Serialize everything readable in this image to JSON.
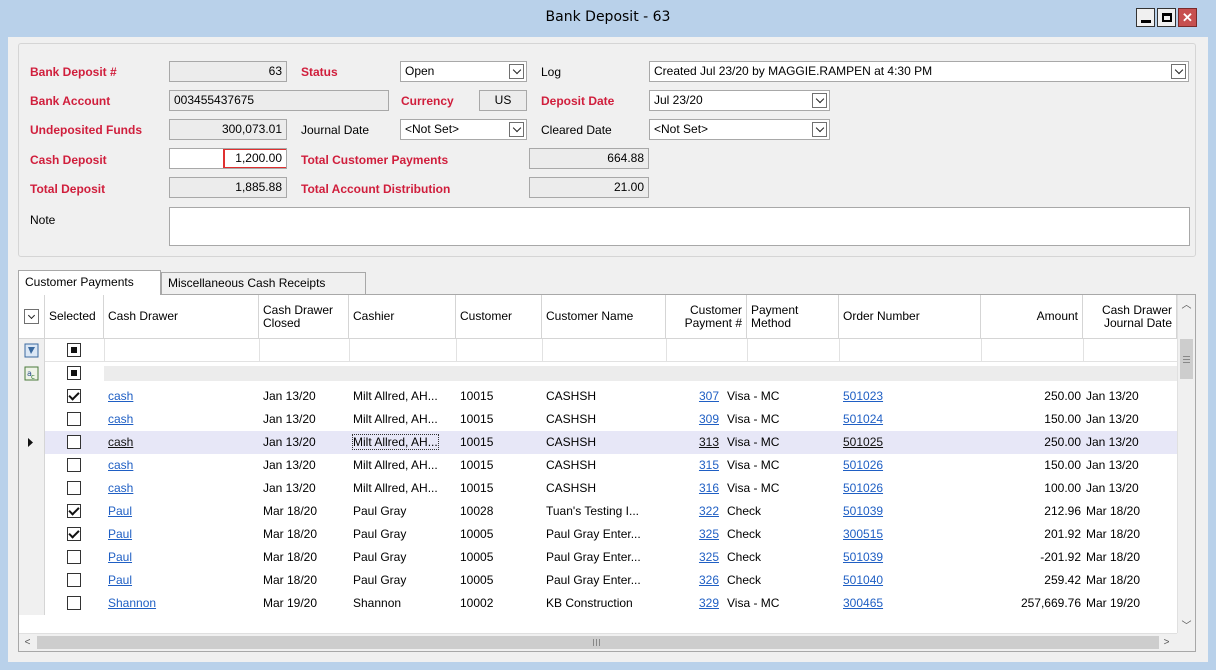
{
  "window": {
    "title": "Bank Deposit - 63"
  },
  "header": {
    "bank_deposit_label": "Bank Deposit #",
    "bank_deposit_value": "63",
    "status_label": "Status",
    "status_value": "Open",
    "log_label": "Log",
    "log_value": "Created Jul 23/20 by MAGGIE.RAMPEN at 4:30 PM",
    "bank_account_label": "Bank Account",
    "bank_account_value": "003455437675",
    "currency_label": "Currency",
    "currency_value": "US",
    "deposit_date_label": "Deposit Date",
    "deposit_date_value": "Jul 23/20",
    "undeposited_label": "Undeposited Funds",
    "undeposited_value": "300,073.01",
    "journal_date_label": "Journal Date",
    "journal_date_value": "<Not Set>",
    "cleared_date_label": "Cleared Date",
    "cleared_date_value": "<Not Set>",
    "cash_deposit_label": "Cash Deposit",
    "cash_deposit_value": "1,200.00",
    "total_customer_payments_label": "Total Customer Payments",
    "total_customer_payments_value": "664.88",
    "total_deposit_label": "Total Deposit",
    "total_deposit_value": "1,885.88",
    "total_account_distribution_label": "Total Account Distribution",
    "total_account_distribution_value": "21.00",
    "note_label": "Note",
    "note_value": ""
  },
  "tabs": [
    {
      "label": "Customer Payments"
    },
    {
      "label": "Miscellaneous Cash Receipts"
    }
  ],
  "grid": {
    "columns": {
      "selected": "Selected",
      "cash_drawer": "Cash Drawer",
      "cash_drawer_closed": "Cash Drawer Closed",
      "cashier": "Cashier",
      "customer": "Customer",
      "customer_name": "Customer Name",
      "customer_payment": "Customer Payment #",
      "payment_method": "Payment Method",
      "order_number": "Order Number",
      "amount": "Amount",
      "cash_drawer_journal_date": "Cash Drawer Journal Date"
    },
    "rows": [
      {
        "selected": "checked",
        "cash_drawer": "cash",
        "closed": "Jan 13/20",
        "cashier": "Milt Allred, AH...",
        "customer": "10015",
        "customer_name": "CASHSH",
        "payment": "307",
        "method": "Visa - MC",
        "order": "501023",
        "amount": "250.00",
        "journal_date": "Jan 13/20"
      },
      {
        "selected": "unchecked",
        "cash_drawer": "cash",
        "closed": "Jan 13/20",
        "cashier": "Milt Allred, AH...",
        "customer": "10015",
        "customer_name": "CASHSH",
        "payment": "309",
        "method": "Visa - MC",
        "order": "501024",
        "amount": "150.00",
        "journal_date": "Jan 13/20"
      },
      {
        "selected": "unchecked",
        "cash_drawer": "cash",
        "closed": "Jan 13/20",
        "cashier": "Milt Allred, AH...",
        "customer": "10015",
        "customer_name": "CASHSH",
        "payment": "313",
        "method": "Visa - MC",
        "order": "501025",
        "amount": "250.00",
        "journal_date": "Jan 13/20",
        "current": true
      },
      {
        "selected": "unchecked",
        "cash_drawer": "cash",
        "closed": "Jan 13/20",
        "cashier": "Milt Allred, AH...",
        "customer": "10015",
        "customer_name": "CASHSH",
        "payment": "315",
        "method": "Visa - MC",
        "order": "501026",
        "amount": "150.00",
        "journal_date": "Jan 13/20"
      },
      {
        "selected": "unchecked",
        "cash_drawer": "cash",
        "closed": "Jan 13/20",
        "cashier": "Milt Allred, AH...",
        "customer": "10015",
        "customer_name": "CASHSH",
        "payment": "316",
        "method": "Visa - MC",
        "order": "501026",
        "amount": "100.00",
        "journal_date": "Jan 13/20"
      },
      {
        "selected": "checked",
        "cash_drawer": "Paul",
        "closed": "Mar 18/20",
        "cashier": "Paul Gray",
        "customer": "10028",
        "customer_name": "Tuan's Testing I...",
        "payment": "322",
        "method": "Check",
        "order": "501039",
        "amount": "212.96",
        "journal_date": "Mar 18/20"
      },
      {
        "selected": "checked",
        "cash_drawer": "Paul",
        "closed": "Mar 18/20",
        "cashier": "Paul Gray",
        "customer": "10005",
        "customer_name": "Paul Gray Enter...",
        "payment": "325",
        "method": "Check",
        "order": "300515",
        "amount": "201.92",
        "journal_date": "Mar 18/20"
      },
      {
        "selected": "unchecked",
        "cash_drawer": "Paul",
        "closed": "Mar 18/20",
        "cashier": "Paul Gray",
        "customer": "10005",
        "customer_name": "Paul Gray Enter...",
        "payment": "325",
        "method": "Check",
        "order": "501039",
        "amount": "-201.92",
        "journal_date": "Mar 18/20"
      },
      {
        "selected": "unchecked",
        "cash_drawer": "Paul",
        "closed": "Mar 18/20",
        "cashier": "Paul Gray",
        "customer": "10005",
        "customer_name": "Paul Gray Enter...",
        "payment": "326",
        "method": "Check",
        "order": "501040",
        "amount": "259.42",
        "journal_date": "Mar 18/20"
      },
      {
        "selected": "unchecked",
        "cash_drawer": "Shannon",
        "closed": "Mar 19/20",
        "cashier": "Shannon",
        "customer": "10002",
        "customer_name": "KB Construction",
        "payment": "329",
        "method": "Visa - MC",
        "order": "300465",
        "amount": "257,669.76",
        "journal_date": "Mar 19/20"
      }
    ]
  },
  "colors": {
    "required_label": "#d01e3c",
    "link": "#1f5fc4",
    "current_row": "#e7e7f7",
    "title_bg": "#b9d1ea"
  },
  "icons": [
    "minimize-icon",
    "maximize-icon",
    "close-icon",
    "chevron-down-icon",
    "filter-icon",
    "sort-icon",
    "row-pointer-icon",
    "scroll-up-icon",
    "scroll-down-icon",
    "scroll-left-icon",
    "scroll-right-icon"
  ]
}
